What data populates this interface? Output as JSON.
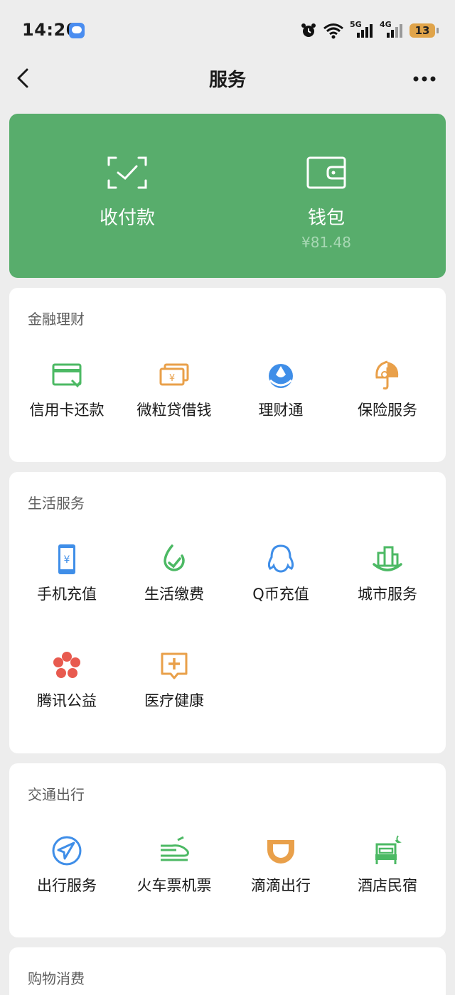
{
  "status_bar": {
    "time": "14:20",
    "battery": "13",
    "signal_5g": "5G",
    "signal_4g": "4G"
  },
  "nav": {
    "title": "服务"
  },
  "hero": {
    "pay_label": "收付款",
    "wallet_label": "钱包",
    "wallet_balance": "¥81.48"
  },
  "sections": {
    "finance": {
      "title": "金融理财",
      "items": [
        "信用卡还款",
        "微粒贷借钱",
        "理财通",
        "保险服务"
      ]
    },
    "life": {
      "title": "生活服务",
      "items": [
        "手机充值",
        "生活缴费",
        "Q币充值",
        "城市服务",
        "腾讯公益",
        "医疗健康"
      ]
    },
    "transport": {
      "title": "交通出行",
      "items": [
        "出行服务",
        "火车票机票",
        "滴滴出行",
        "酒店民宿"
      ]
    },
    "shopping": {
      "title": "购物消费"
    }
  },
  "icons": {
    "green": "#4cb964",
    "orange": "#e9a04a",
    "blue": "#3f8ee8",
    "red": "#e85a4f"
  }
}
